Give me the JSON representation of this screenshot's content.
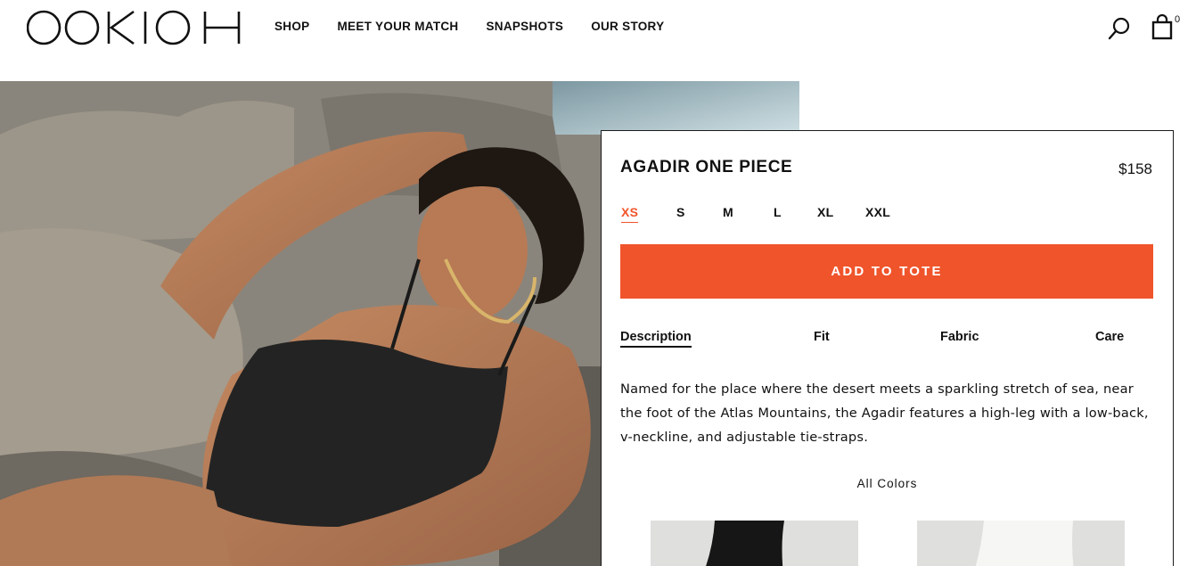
{
  "brand": {
    "logo_text": "OOKIOH"
  },
  "nav": {
    "items": [
      {
        "label": "SHOP"
      },
      {
        "label": "MEET YOUR MATCH"
      },
      {
        "label": "SNAPSHOTS"
      },
      {
        "label": "OUR STORY"
      }
    ]
  },
  "header": {
    "search_icon": "search-icon",
    "bag_icon": "shopping-bag-icon",
    "bag_count": "0"
  },
  "hero": {
    "alt": "Model in black one piece swimsuit on rocks"
  },
  "product": {
    "title": "AGADIR ONE PIECE",
    "price": "$158",
    "sizes": [
      "XS",
      "S",
      "M",
      "L",
      "XL",
      "XXL"
    ],
    "selected_size": "XS",
    "add_button": "ADD TO TOTE",
    "tabs": [
      "Description",
      "Fit",
      "Fabric",
      "Care"
    ],
    "active_tab": "Description",
    "description": "Named for the place where the desert meets a sparkling stretch of sea, near the foot of the Atlas Mountains, the Agadir features a high-leg with a low-back, v-neckline, and adjustable tie-straps.",
    "all_colors_label": "All Colors",
    "swatches": [
      {
        "color": "black"
      },
      {
        "color": "white"
      }
    ]
  },
  "colors": {
    "accent": "#f0542b",
    "text": "#111111",
    "border": "#1c1c1c",
    "swatch_bg": "#dfdfdd"
  }
}
